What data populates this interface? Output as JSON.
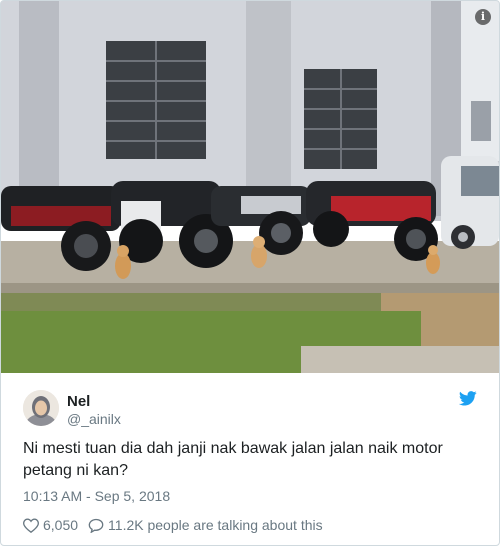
{
  "photo": {
    "alt_icon": "info-icon",
    "info_label": "i"
  },
  "tweet": {
    "author": {
      "name": "Nel",
      "handle": "@_ainilx",
      "avatar_icon": "avatar"
    },
    "brand_icon": "twitter-bird-icon",
    "text": "Ni mesti tuan dia dah janji nak bawak jalan jalan naik motor petang ni kan?",
    "timestamp": "10:13 AM - Sep 5, 2018",
    "likes": "6,050",
    "replies_label": "11.2K people are talking about this",
    "colors": {
      "brand": "#1da1f2",
      "secondary_text": "#697882",
      "primary_text": "#1c2022"
    }
  }
}
